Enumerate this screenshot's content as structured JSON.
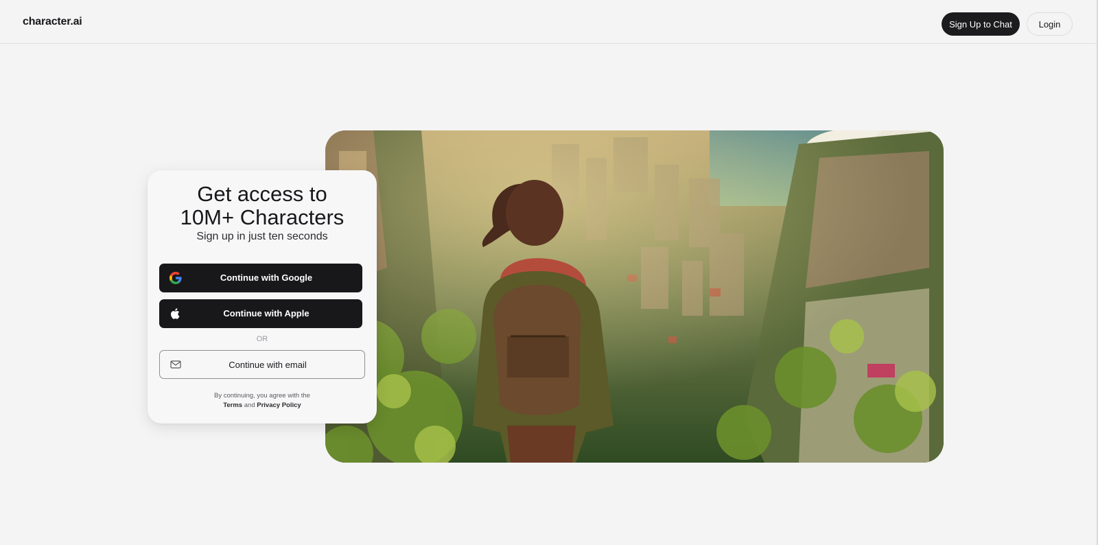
{
  "header": {
    "logo": "character.ai",
    "signup_label": "Sign Up to Chat",
    "login_label": "Login"
  },
  "card": {
    "title_line1": "Get access to",
    "title_line2": "10M+ Characters",
    "subtitle": "Sign up in just ten seconds",
    "google_label": "Continue with Google",
    "apple_label": "Continue with Apple",
    "or_label": "OR",
    "email_label": "Continue with email",
    "legal_prefix": "By continuing, you agree with the",
    "terms_label": "Terms",
    "and_label": "and",
    "privacy_label": "Privacy Policy"
  },
  "icons": {
    "google": "google-icon",
    "apple": "apple-icon",
    "email": "mail-icon"
  },
  "colors": {
    "background": "#f4f4f4",
    "primary_button": "#18181b",
    "primary_text": "#ffffff"
  }
}
